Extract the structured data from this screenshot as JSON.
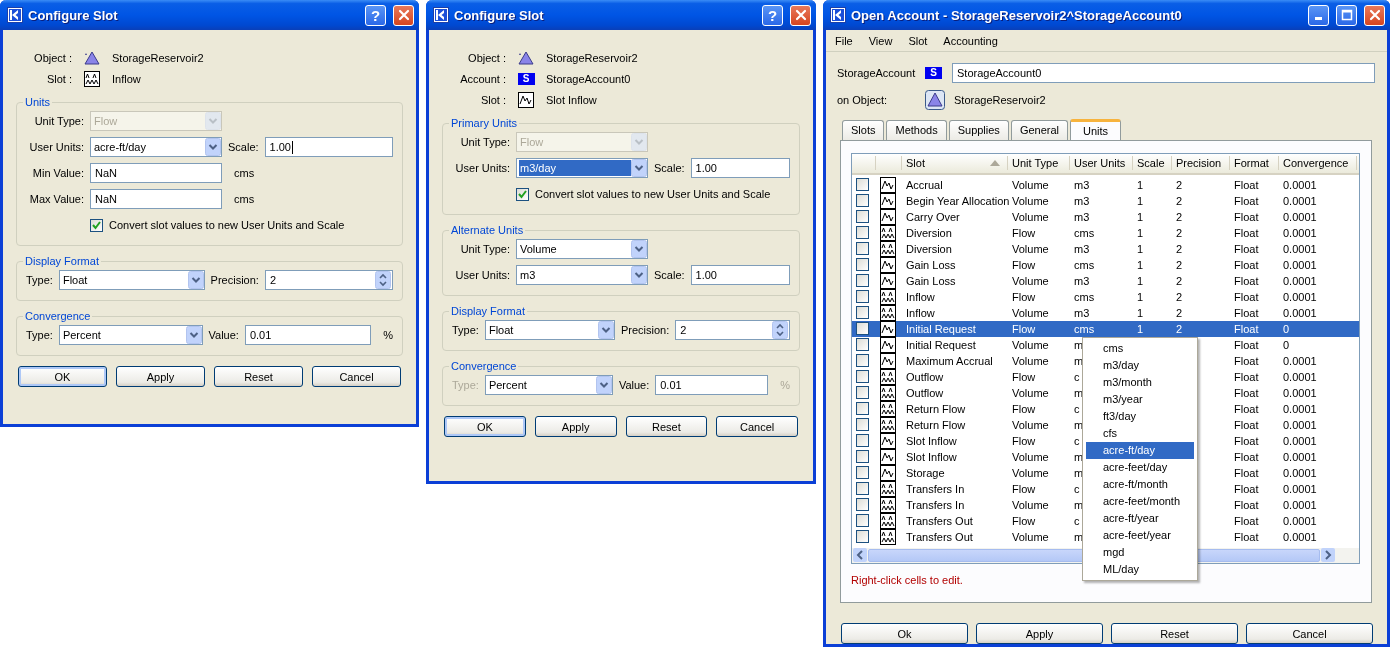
{
  "windows": [
    {
      "kind": "dialog",
      "title": "Configure Slot",
      "controls": [
        {
          "kind": "help",
          "glyph": "?"
        },
        {
          "kind": "close"
        }
      ],
      "info": [
        {
          "label": "Object :",
          "kind": "object",
          "value": "StorageReservoir2"
        },
        {
          "label": "Slot :",
          "kind": "slot_multi",
          "value": "Inflow"
        }
      ],
      "groups": [
        {
          "title": "Units",
          "rows": [
            [
              {
                "kind": "select",
                "label": "Unit Type:",
                "value": "Flow",
                "disabled": true
              }
            ],
            [
              {
                "kind": "select",
                "label": "User Units:",
                "value": "acre-ft/day"
              },
              {
                "kind": "text",
                "label": "Scale:",
                "value": "1.00",
                "caret": true
              }
            ],
            [
              {
                "kind": "text",
                "label": "Min Value:",
                "value": "NaN",
                "suffix": "cms"
              }
            ],
            [
              {
                "kind": "text",
                "label": "Max Value:",
                "value": "NaN",
                "suffix": "cms"
              }
            ],
            [
              {
                "kind": "checkbox",
                "label": "Convert slot values to new User Units and Scale",
                "checked": true
              }
            ]
          ]
        },
        {
          "title": "Display Format",
          "rows": [
            [
              {
                "kind": "select",
                "label": "Type:",
                "value": "Float"
              },
              {
                "kind": "spin",
                "label": "Precision:",
                "value": "2"
              }
            ]
          ]
        },
        {
          "title": "Convergence",
          "rows": [
            [
              {
                "kind": "select",
                "label": "Type:",
                "value": "Percent"
              },
              {
                "kind": "text",
                "label": "Value:",
                "value": "0.01",
                "suffix": "%"
              }
            ]
          ]
        }
      ],
      "buttons": [
        {
          "label": "OK",
          "default": true
        },
        {
          "label": "Apply",
          "default": false
        },
        {
          "label": "Reset",
          "default": false
        },
        {
          "label": "Cancel",
          "default": false
        }
      ]
    },
    {
      "kind": "dialog",
      "title": "Configure Slot",
      "controls": [
        {
          "kind": "help",
          "glyph": "?"
        },
        {
          "kind": "close"
        }
      ],
      "info": [
        {
          "label": "Object :",
          "kind": "object",
          "value": "StorageReservoir2"
        },
        {
          "label": "Account :",
          "kind": "account",
          "badge": "S",
          "value": "StorageAccount0"
        },
        {
          "label": "Slot :",
          "kind": "slot_single",
          "value": "Slot Inflow"
        }
      ],
      "groups": [
        {
          "title": "Primary Units",
          "rows": [
            [
              {
                "kind": "select",
                "label": "Unit Type:",
                "value": "Flow",
                "disabled": true
              }
            ],
            [
              {
                "kind": "select",
                "label": "User Units:",
                "value": "m3/day",
                "highlighted": true
              },
              {
                "kind": "text",
                "label": "Scale:",
                "value": "1.00"
              }
            ],
            [
              {
                "kind": "checkbox",
                "label": "Convert slot values to new User Units and Scale",
                "checked": true
              }
            ]
          ]
        },
        {
          "title": "Alternate Units",
          "rows": [
            [
              {
                "kind": "select",
                "label": "Unit Type:",
                "value": "Volume"
              }
            ],
            [
              {
                "kind": "select",
                "label": "User Units:",
                "value": "m3"
              },
              {
                "kind": "text",
                "label": "Scale:",
                "value": "1.00"
              }
            ]
          ]
        },
        {
          "title": "Display Format",
          "rows": [
            [
              {
                "kind": "select",
                "label": "Type:",
                "value": "Float"
              },
              {
                "kind": "spin",
                "label": "Precision:",
                "value": "2"
              }
            ]
          ]
        },
        {
          "title": "Convergence",
          "rows": [
            [
              {
                "kind": "select",
                "label": "Type:",
                "value": "Percent",
                "label_disabled": true
              },
              {
                "kind": "text",
                "label": "Value:",
                "value": "0.01",
                "suffix": "%",
                "suffix_disabled": true
              }
            ]
          ]
        }
      ],
      "buttons": [
        {
          "label": "OK",
          "default": true
        },
        {
          "label": "Apply",
          "default": false
        },
        {
          "label": "Reset",
          "default": false
        },
        {
          "label": "Cancel",
          "default": false
        }
      ]
    },
    {
      "kind": "account",
      "title": "Open Account - StorageReservoir2^StorageAccount0",
      "controls": [
        {
          "kind": "minimize"
        },
        {
          "kind": "maximize"
        },
        {
          "kind": "close"
        }
      ],
      "menu": [
        "File",
        "View",
        "Slot",
        "Accounting"
      ],
      "account": {
        "label": "StorageAccount",
        "badge": "S",
        "value": "StorageAccount0"
      },
      "object": {
        "label": "on Object:",
        "value": "StorageReservoir2"
      },
      "tabs": [
        {
          "label": "Slots",
          "selected": false
        },
        {
          "label": "Methods",
          "selected": false
        },
        {
          "label": "Supplies",
          "selected": false
        },
        {
          "label": "General",
          "selected": false
        },
        {
          "label": "Units",
          "selected": true
        }
      ],
      "table": {
        "columns": [
          {
            "label": "Slot",
            "sorted": true
          },
          {
            "label": "Unit Type",
            "sorted": false
          },
          {
            "label": "User Units",
            "sorted": false
          },
          {
            "label": "Scale",
            "sorted": false
          },
          {
            "label": "Precision",
            "sorted": false
          },
          {
            "label": "Format",
            "sorted": false
          },
          {
            "label": "Convergence",
            "sorted": false
          }
        ],
        "rows": [
          {
            "kind": "slot_single",
            "checked": false,
            "selected": false,
            "cells": [
              "Accrual",
              "Volume",
              "m3",
              "1",
              "2",
              "Float",
              "0.0001"
            ]
          },
          {
            "kind": "slot_single",
            "checked": false,
            "selected": false,
            "cells": [
              "Begin Year Allocation",
              "Volume",
              "m3",
              "1",
              "2",
              "Float",
              "0.0001"
            ]
          },
          {
            "kind": "slot_single",
            "checked": false,
            "selected": false,
            "cells": [
              "Carry Over",
              "Volume",
              "m3",
              "1",
              "2",
              "Float",
              "0.0001"
            ]
          },
          {
            "kind": "slot_multi",
            "checked": false,
            "selected": false,
            "cells": [
              "Diversion",
              "Flow",
              "cms",
              "1",
              "2",
              "Float",
              "0.0001"
            ]
          },
          {
            "kind": "slot_multi",
            "checked": false,
            "selected": false,
            "cells": [
              "Diversion",
              "Volume",
              "m3",
              "1",
              "2",
              "Float",
              "0.0001"
            ]
          },
          {
            "kind": "slot_single",
            "checked": false,
            "selected": false,
            "cells": [
              "Gain Loss",
              "Flow",
              "cms",
              "1",
              "2",
              "Float",
              "0.0001"
            ]
          },
          {
            "kind": "slot_single",
            "checked": false,
            "selected": false,
            "cells": [
              "Gain Loss",
              "Volume",
              "m3",
              "1",
              "2",
              "Float",
              "0.0001"
            ]
          },
          {
            "kind": "slot_multi",
            "checked": false,
            "selected": false,
            "cells": [
              "Inflow",
              "Flow",
              "cms",
              "1",
              "2",
              "Float",
              "0.0001"
            ]
          },
          {
            "kind": "slot_multi",
            "checked": false,
            "selected": false,
            "cells": [
              "Inflow",
              "Volume",
              "m3",
              "1",
              "2",
              "Float",
              "0.0001"
            ]
          },
          {
            "kind": "slot_single",
            "checked": false,
            "selected": true,
            "cells": [
              "Initial Request",
              "Flow",
              "cms",
              "1",
              "2",
              "Float",
              "0"
            ]
          },
          {
            "kind": "slot_single",
            "checked": false,
            "selected": false,
            "cells": [
              "Initial Request",
              "Volume",
              "m",
              null,
              null,
              "Float",
              "0"
            ]
          },
          {
            "kind": "slot_single",
            "checked": false,
            "selected": false,
            "cells": [
              "Maximum Accrual",
              "Volume",
              "m",
              null,
              null,
              "Float",
              "0.0001"
            ]
          },
          {
            "kind": "slot_multi",
            "checked": false,
            "selected": false,
            "cells": [
              "Outflow",
              "Flow",
              "c",
              null,
              null,
              "Float",
              "0.0001"
            ]
          },
          {
            "kind": "slot_multi",
            "checked": false,
            "selected": false,
            "cells": [
              "Outflow",
              "Volume",
              "m",
              null,
              null,
              "Float",
              "0.0001"
            ]
          },
          {
            "kind": "slot_multi",
            "checked": false,
            "selected": false,
            "cells": [
              "Return Flow",
              "Flow",
              "c",
              null,
              null,
              "Float",
              "0.0001"
            ]
          },
          {
            "kind": "slot_multi",
            "checked": false,
            "selected": false,
            "cells": [
              "Return Flow",
              "Volume",
              "m",
              null,
              null,
              "Float",
              "0.0001"
            ]
          },
          {
            "kind": "slot_single",
            "checked": false,
            "selected": false,
            "cells": [
              "Slot Inflow",
              "Flow",
              "c",
              null,
              null,
              "Float",
              "0.0001"
            ]
          },
          {
            "kind": "slot_single",
            "checked": false,
            "selected": false,
            "cells": [
              "Slot Inflow",
              "Volume",
              "m",
              null,
              null,
              "Float",
              "0.0001"
            ]
          },
          {
            "kind": "slot_single",
            "checked": false,
            "selected": false,
            "cells": [
              "Storage",
              "Volume",
              "m",
              null,
              null,
              "Float",
              "0.0001"
            ]
          },
          {
            "kind": "slot_multi",
            "checked": false,
            "selected": false,
            "cells": [
              "Transfers In",
              "Flow",
              "c",
              null,
              null,
              "Float",
              "0.0001"
            ]
          },
          {
            "kind": "slot_multi",
            "checked": false,
            "selected": false,
            "cells": [
              "Transfers In",
              "Volume",
              "m",
              null,
              null,
              "Float",
              "0.0001"
            ]
          },
          {
            "kind": "slot_multi",
            "checked": false,
            "selected": false,
            "cells": [
              "Transfers Out",
              "Flow",
              "c",
              null,
              null,
              "Float",
              "0.0001"
            ]
          },
          {
            "kind": "slot_multi",
            "checked": false,
            "selected": false,
            "cells": [
              "Transfers Out",
              "Volume",
              "m",
              null,
              null,
              "Float",
              "0.0001"
            ]
          }
        ]
      },
      "popup_menu": [
        {
          "label": "cms",
          "selected": false
        },
        {
          "label": "m3/day",
          "selected": false
        },
        {
          "label": "m3/month",
          "selected": false
        },
        {
          "label": "m3/year",
          "selected": false
        },
        {
          "label": "ft3/day",
          "selected": false
        },
        {
          "label": "cfs",
          "selected": false
        },
        {
          "label": "acre-ft/day",
          "selected": true
        },
        {
          "label": "acre-feet/day",
          "selected": false
        },
        {
          "label": "acre-ft/month",
          "selected": false
        },
        {
          "label": "acre-feet/month",
          "selected": false
        },
        {
          "label": "acre-ft/year",
          "selected": false
        },
        {
          "label": "acre-feet/year",
          "selected": false
        },
        {
          "label": "mgd",
          "selected": false
        },
        {
          "label": "ML/day",
          "selected": false
        }
      ],
      "hint": "Right-click cells to edit.",
      "buttons": [
        {
          "label": "Ok",
          "default": false
        },
        {
          "label": "Apply",
          "default": false
        },
        {
          "label": "Reset",
          "default": false
        },
        {
          "label": "Cancel",
          "default": false
        }
      ]
    }
  ]
}
